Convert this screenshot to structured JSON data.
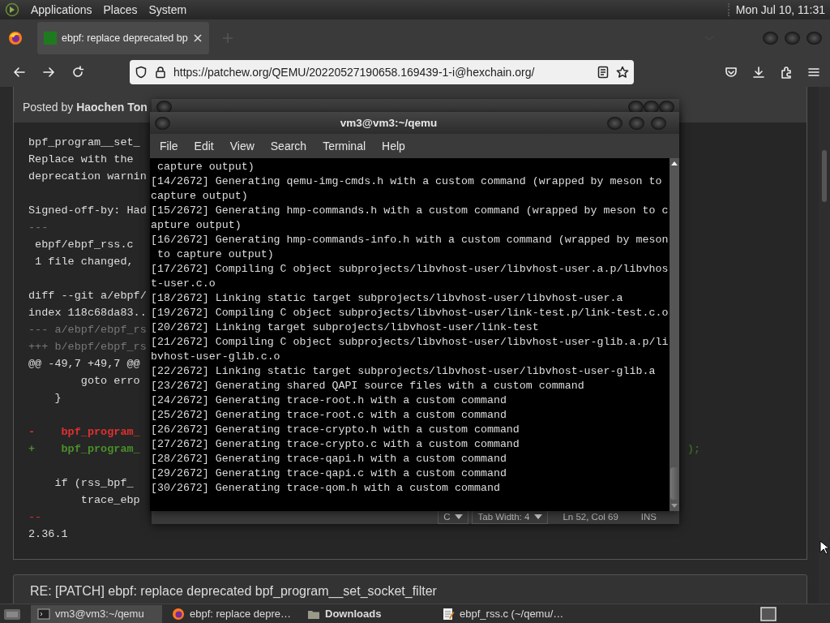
{
  "top_panel": {
    "menus": [
      "Applications",
      "Places",
      "System"
    ],
    "clock": "Mon Jul 10, 11:31"
  },
  "browser": {
    "tabs": [
      {
        "title": "ebpf: replace deprecated bp",
        "selected": true
      }
    ],
    "url": "https://patchew.org/QEMU/20220527190658.169439-1-i@hexchain.org/",
    "page": {
      "message": {
        "byline": "Posted by **Haochen Ton**",
        "lines": [
          {
            "kind": "plain",
            "text": "bpf_program__set_"
          },
          {
            "kind": "plain",
            "text": "Replace with the"
          },
          {
            "kind": "plain",
            "text": "deprecation warnin"
          },
          {
            "kind": "blank"
          },
          {
            "kind": "plain",
            "text": "Signed-off-by: Had"
          },
          {
            "kind": "muted",
            "text": "---"
          },
          {
            "kind": "plain",
            "text": " ebpf/ebpf_rss.c"
          },
          {
            "kind": "plain",
            "text": " 1 file changed,"
          },
          {
            "kind": "blank"
          },
          {
            "kind": "plain",
            "text": "diff --git a/ebpf/"
          },
          {
            "kind": "plain",
            "text": "index 118c68da83.."
          },
          {
            "kind": "muted",
            "text": "--- a/ebpf/ebpf_rs"
          },
          {
            "kind": "muted",
            "text": "+++ b/ebpf/ebpf_rs"
          },
          {
            "kind": "plain",
            "text": "@@ -49,7 +49,7 @@"
          },
          {
            "kind": "plain",
            "text": "        goto erro"
          },
          {
            "kind": "plain",
            "text": "    }"
          },
          {
            "kind": "blank"
          },
          {
            "kind": "removed",
            "text": "-    bpf_program_"
          },
          {
            "kind": "added",
            "text": "+    bpf_program_",
            "tail": ");"
          },
          {
            "kind": "blank"
          },
          {
            "kind": "plain",
            "text": "    if (rss_bpf_"
          },
          {
            "kind": "plain",
            "text": "        trace_ebp"
          },
          {
            "kind": "separator",
            "text": "--"
          },
          {
            "kind": "plain",
            "text": "2.36.1"
          }
        ]
      },
      "reply_subject": "RE: [PATCH] ebpf: replace deprecated bpf_program__set_socket_filter"
    }
  },
  "editor_window": {
    "status_bar": {
      "language": "C",
      "tab_width": "Tab Width:  4",
      "position": "Ln 52, Col 69",
      "mode": "INS"
    }
  },
  "terminal_window": {
    "title": "vm3@vm3:~/qemu",
    "menus": [
      "File",
      "Edit",
      "View",
      "Search",
      "Terminal",
      "Help"
    ],
    "lines": [
      " capture output)",
      "[14/2672] Generating qemu-img-cmds.h with a custom command (wrapped by meson to",
      "capture output)",
      "[15/2672] Generating hmp-commands.h with a custom command (wrapped by meson to c",
      "apture output)",
      "[16/2672] Generating hmp-commands-info.h with a custom command (wrapped by meson",
      " to capture output)",
      "[17/2672] Compiling C object subprojects/libvhost-user/libvhost-user.a.p/libvhos",
      "t-user.c.o",
      "[18/2672] Linking static target subprojects/libvhost-user/libvhost-user.a",
      "[19/2672] Compiling C object subprojects/libvhost-user/link-test.p/link-test.c.o",
      "[20/2672] Linking target subprojects/libvhost-user/link-test",
      "[21/2672] Compiling C object subprojects/libvhost-user/libvhost-user-glib.a.p/li",
      "bvhost-user-glib.c.o",
      "[22/2672] Linking static target subprojects/libvhost-user/libvhost-user-glib.a",
      "[23/2672] Generating shared QAPI source files with a custom command",
      "[24/2672] Generating trace-root.h with a custom command",
      "[25/2672] Generating trace-root.c with a custom command",
      "[26/2672] Generating trace-crypto.h with a custom command",
      "[27/2672] Generating trace-crypto.c with a custom command",
      "[28/2672] Generating trace-qapi.h with a custom command",
      "[29/2672] Generating trace-qapi.c with a custom command",
      "[30/2672] Generating trace-qom.h with a custom command"
    ]
  },
  "taskbar": {
    "items": [
      {
        "kind": "terminal",
        "label": "vm3@vm3:~/qemu",
        "selected": true,
        "urgent": false
      },
      {
        "kind": "browser",
        "label": "ebpf: replace depre…",
        "selected": false,
        "urgent": false
      },
      {
        "kind": "folder",
        "label": "Downloads",
        "selected": false,
        "urgent": true
      },
      {
        "kind": "editor",
        "label": "ebpf_rss.c (~/qemu/…",
        "selected": false,
        "urgent": false
      }
    ]
  }
}
